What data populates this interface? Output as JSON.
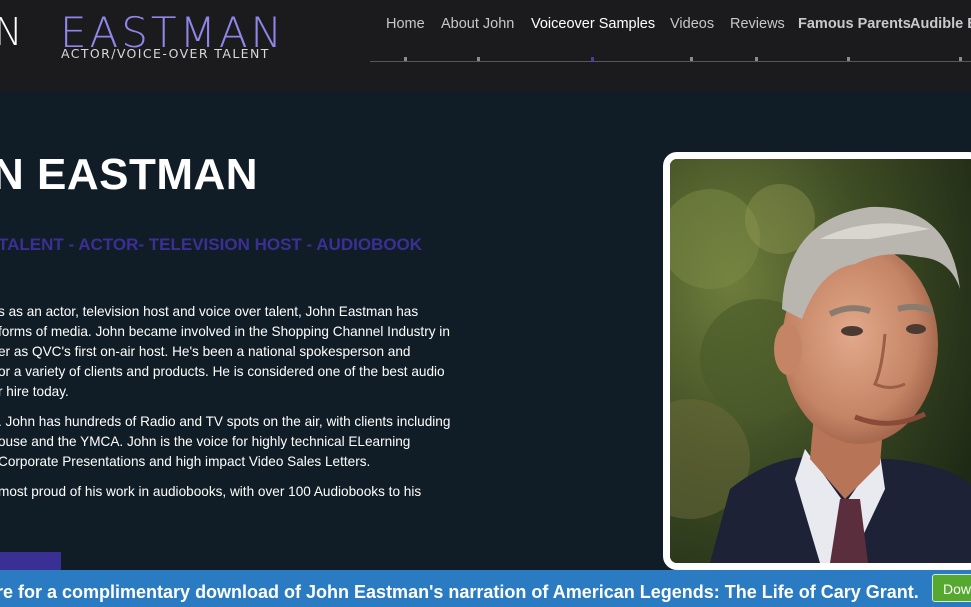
{
  "header": {
    "logo_first": "N",
    "logo_last": "EASTMAN",
    "logo_tagline": "ACTOR/VOICE-OVER TALENT"
  },
  "nav": {
    "items": [
      {
        "label": "Home"
      },
      {
        "label": "About John"
      },
      {
        "label": "Voiceover Samples"
      },
      {
        "label": "Videos"
      },
      {
        "label": "Reviews"
      },
      {
        "label": "Famous Parents"
      },
      {
        "label": "Audible B"
      }
    ],
    "active_index": 2
  },
  "hero": {
    "title": "N EASTMAN",
    "subtitle": "TALENT - ACTOR- TELEVISION HOST - AUDIOBOOK"
  },
  "bio": {
    "p1": [
      "s as an actor, television host and voice over talent, John Eastman has",
      "forms of media. John became involved in the Shopping Channel Industry in",
      "er as QVC's first on-air host. He's been a national spokesperson and",
      "or a variety of clients and products. He is considered one of the best audio",
      "r hire today."
    ],
    "p2": [
      ". John has hundreds of Radio and TV spots on the air, with clients including",
      "ouse and the YMCA. John is the voice for highly technical ELearning",
      " Corporate Presentations and high impact Video Sales Letters."
    ],
    "p3": [
      "most proud of his work in audiobooks, with over 100 Audiobooks to his"
    ]
  },
  "promo": {
    "text": "re for a complimentary download of John Eastman's narration of American Legends: The Life of Cary Grant.",
    "button_label": "Dow"
  },
  "colors": {
    "accent_purple": "#8f86e8",
    "subtitle_purple": "#3b2f95",
    "promo_blue": "#2b7bc2",
    "download_green": "#55a830"
  }
}
